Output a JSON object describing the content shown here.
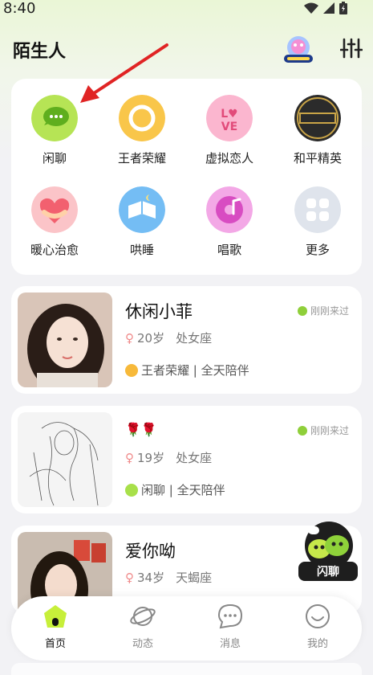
{
  "status_bar": {
    "time": "8:40"
  },
  "header": {
    "title": "陌生人"
  },
  "categories": [
    {
      "label": "闲聊",
      "icon": "chat-bubble-icon",
      "color": "#a8e04a"
    },
    {
      "label": "王者荣耀",
      "icon": "honor-of-kings-icon",
      "color": "#f7b93a"
    },
    {
      "label": "虚拟恋人",
      "icon": "love-icon",
      "color": "#f9a8c4"
    },
    {
      "label": "和平精英",
      "icon": "peace-elite-icon",
      "color": "#3a3a3a"
    },
    {
      "label": "暖心治愈",
      "icon": "hug-heart-icon",
      "color": "#f57d8c"
    },
    {
      "label": "哄睡",
      "icon": "book-moon-icon",
      "color": "#6bb8f2"
    },
    {
      "label": "唱歌",
      "icon": "music-disc-icon",
      "color": "#e46fd0"
    },
    {
      "label": "更多",
      "icon": "grid-more-icon",
      "color": "#d7dde8"
    }
  ],
  "users": [
    {
      "name": "休闲小菲",
      "status": "刚刚来过",
      "age": "20岁",
      "zodiac": "处女座",
      "tags": "王者荣耀 | 全天陪伴"
    },
    {
      "name": "🌹🌹",
      "status": "刚刚来过",
      "age": "19岁",
      "zodiac": "处女座",
      "tags": "闲聊 | 全天陪伴"
    },
    {
      "name": "爱你呦",
      "status": "",
      "age": "34岁",
      "zodiac": "天蝎座",
      "tags": ""
    }
  ],
  "float_button": {
    "label": "闪聊"
  },
  "tabs": [
    {
      "label": "首页",
      "icon": "home-icon",
      "active": true
    },
    {
      "label": "动态",
      "icon": "planet-icon",
      "active": false
    },
    {
      "label": "消息",
      "icon": "message-icon",
      "active": false
    },
    {
      "label": "我的",
      "icon": "smile-face-icon",
      "active": false
    }
  ]
}
